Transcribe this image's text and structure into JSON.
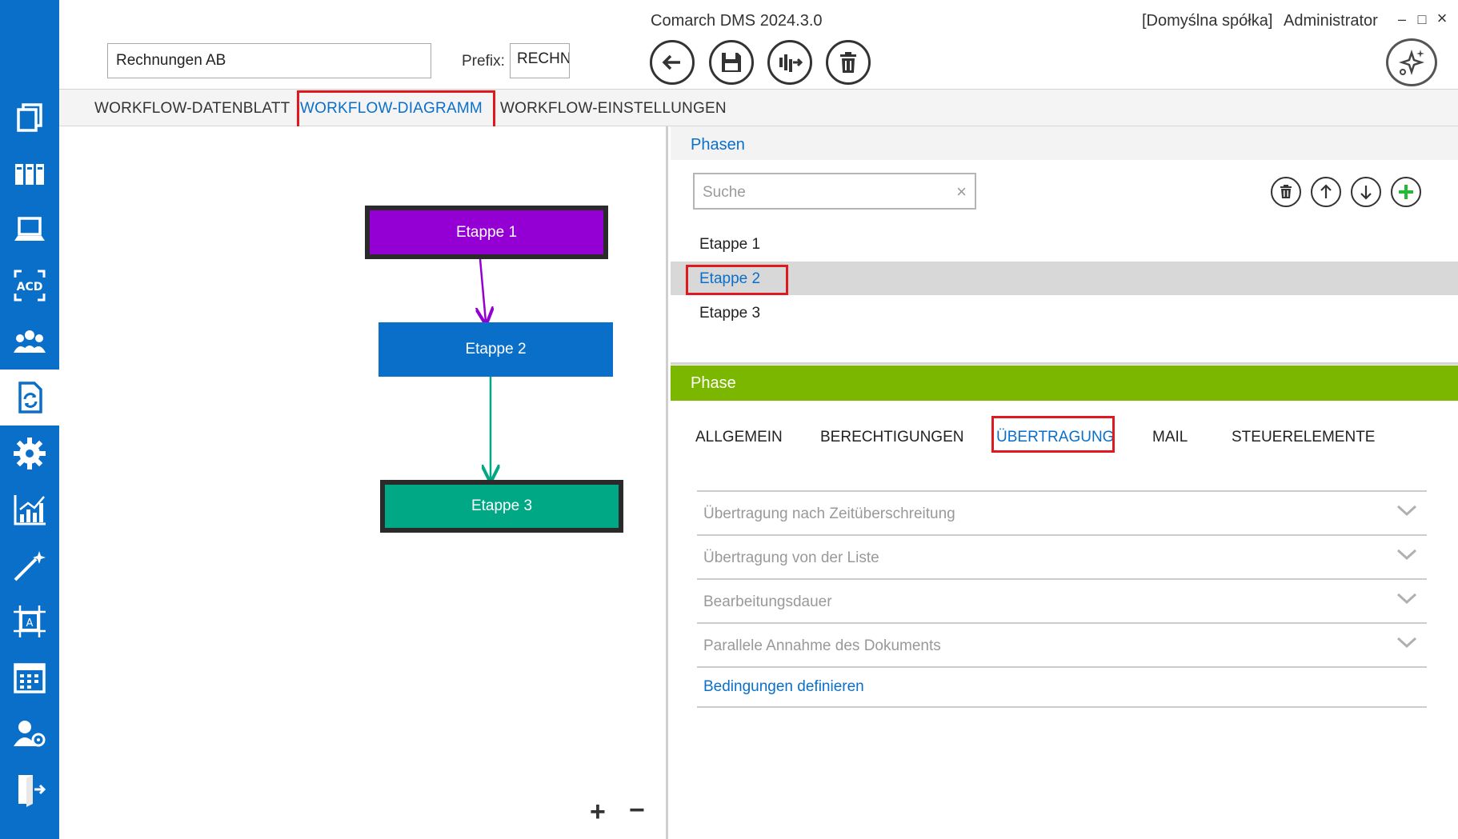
{
  "app": {
    "title": "Comarch DMS 2024.3.0",
    "company": "[Domyślna spółka]",
    "user": "Administrator",
    "minimize": "–",
    "maximize": "□",
    "close": "×"
  },
  "workflow": {
    "name": "Rechnungen AB",
    "prefix_label": "Prefix:",
    "prefix_value": "RECHN"
  },
  "sidebar": {
    "items": [
      {
        "icon": "documents-icon"
      },
      {
        "icon": "binders-icon"
      },
      {
        "icon": "laptop-icon"
      },
      {
        "icon": "ocr-acd-icon"
      },
      {
        "icon": "users-group-icon"
      },
      {
        "icon": "workflow-document-icon",
        "active": true
      },
      {
        "icon": "gear-icon"
      },
      {
        "icon": "chart-icon"
      },
      {
        "icon": "magic-wand-icon"
      },
      {
        "icon": "text-frame-icon"
      },
      {
        "icon": "calendar-icon"
      },
      {
        "icon": "user-settings-icon"
      },
      {
        "icon": "exit-icon"
      }
    ]
  },
  "tabs": {
    "datasheet": "WORKFLOW-DATENBLATT",
    "diagram": "WORKFLOW-DIAGRAMM",
    "settings": "WORKFLOW-EINSTELLUNGEN",
    "active": "WORKFLOW-DIAGRAMM"
  },
  "diagram": {
    "nodes": [
      {
        "label": "Etappe 1",
        "color": "#9400d3"
      },
      {
        "label": "Etappe  2",
        "color": "#0a6fc9"
      },
      {
        "label": "Etappe 3",
        "color": "#00a885"
      }
    ],
    "arrow_colors": [
      "#9400d3",
      "#00a885"
    ],
    "zoom_in": "+",
    "zoom_out": "−"
  },
  "phasen": {
    "title": "Phasen",
    "search_placeholder": "Suche",
    "clear": "×",
    "items": [
      "Etappe 1",
      "Etappe  2",
      "Etappe 3"
    ],
    "selected": "Etappe  2"
  },
  "phase": {
    "title": "Phase",
    "subtabs": [
      "ALLGEMEIN",
      "BERECHTIGUNGEN",
      "ÜBERTRAGUNG",
      "MAIL",
      "STEUERELEMENTE"
    ],
    "active_subtab": "ÜBERTRAGUNG",
    "sections": [
      "Übertragung nach Zeitüberschreitung",
      "Übertragung von der Liste",
      "Bearbeitungsdauer",
      "Parallele Annahme des Dokuments"
    ],
    "link": "Bedingungen definieren"
  },
  "colors": {
    "accent": "#0a6fc9",
    "phase_bar": "#7cb700",
    "highlight": "#e0191f"
  }
}
